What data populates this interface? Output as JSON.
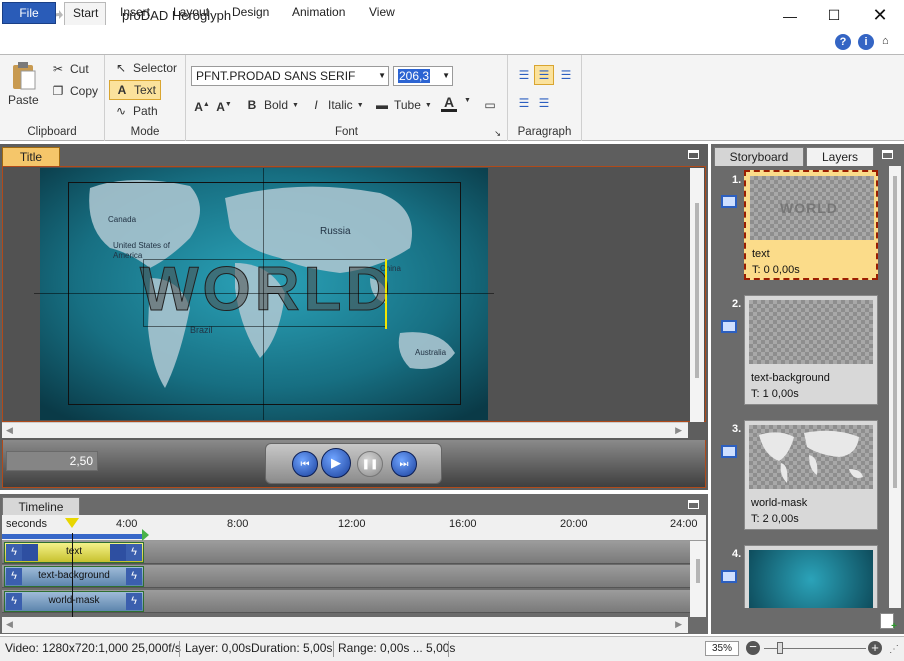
{
  "app": {
    "title": "proDAD Heroglyph"
  },
  "ribbon_tabs": [
    "File",
    "Start",
    "Insert",
    "Layout",
    "Design",
    "Animation",
    "View"
  ],
  "ribbon": {
    "clipboard": {
      "label": "Clipboard",
      "paste": "Paste",
      "cut": "Cut",
      "copy": "Copy"
    },
    "mode": {
      "label": "Mode",
      "selector": "Selector",
      "text": "Text",
      "path": "Path"
    },
    "font": {
      "label": "Font",
      "family": "PFNT.PRODAD SANS SERIF",
      "size": "206,3",
      "bold": "Bold",
      "italic": "Italic",
      "tube": "Tube",
      "color_letter": "A"
    },
    "paragraph": {
      "label": "Paragraph"
    }
  },
  "title_panel": {
    "tab": "Title",
    "time_value": "2,50",
    "map_text": "WORLD",
    "map_labels": [
      "Canada",
      "United States of America",
      "Russia",
      "China",
      "Brazil",
      "Australia"
    ]
  },
  "timeline": {
    "tab": "Timeline",
    "unit_label": "seconds",
    "ticks": [
      "4:00",
      "8:00",
      "12:00",
      "16:00",
      "20:00",
      "24:00"
    ],
    "tracks": [
      {
        "label": "text",
        "selected": true
      },
      {
        "label": "text-background",
        "selected": false
      },
      {
        "label": "world-mask",
        "selected": false
      }
    ]
  },
  "right_panel": {
    "tabs": [
      "Storyboard",
      "Layers"
    ],
    "layers": [
      {
        "num": "1.",
        "name": "text",
        "time": "T: 0  0,00s",
        "thumb_text": "WORLD",
        "selected": true
      },
      {
        "num": "2.",
        "name": "text-background",
        "time": "T: 1  0,00s",
        "selected": false
      },
      {
        "num": "3.",
        "name": "world-mask",
        "time": "T: 2  0,00s",
        "selected": false
      },
      {
        "num": "4.",
        "name": "",
        "time": "",
        "selected": false
      }
    ]
  },
  "status": {
    "video": "Video: 1280x720:1,000  25,000f/s",
    "layer": "Layer: 0,00s",
    "duration": "Duration: 5,00s",
    "range": "Range: 0,00s ... 5,00s",
    "zoom": "35%"
  },
  "colors": {
    "file_tab": "#2a5cb8",
    "selected_layer": "#fbdc8a",
    "title_tab": "#f5c66a",
    "map_sea": "#1d7b8e"
  }
}
